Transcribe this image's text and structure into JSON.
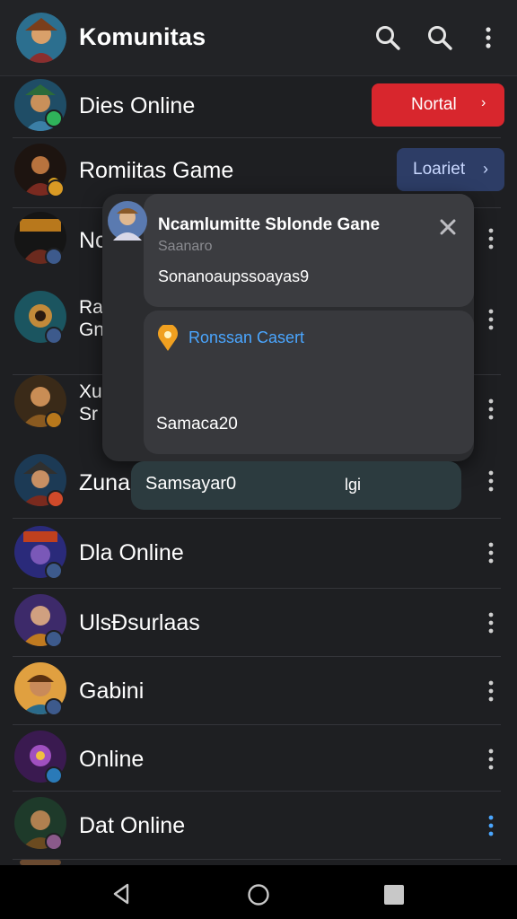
{
  "header": {
    "title": "Komunitas",
    "icons": [
      "search-icon",
      "search-icon",
      "more-vert-icon"
    ]
  },
  "rows": [
    {
      "name": "Dies Online",
      "action": "Nortal"
    },
    {
      "name": "Romiitas Game",
      "action": "Loariet"
    },
    {
      "name": "Nc"
    },
    {
      "name": "Ra\nGn"
    },
    {
      "name": "Xu\nSr"
    },
    {
      "name": "Zuna"
    },
    {
      "name": "Dla Online"
    },
    {
      "name": "UlsĐsurlaas"
    },
    {
      "name": "Gabini"
    },
    {
      "name": "Online"
    },
    {
      "name": "Dat Online"
    }
  ],
  "popup": {
    "title": "Ncamlumitte Sblonde Gane",
    "subtitle": "Saanaro",
    "body1": "Sonanoaupssoayas9",
    "location": "Ronssan Casert",
    "body2": "Samaca20",
    "pill_text": "Samsayar0",
    "pill_tag": "lgi"
  },
  "colors": {
    "accent_red": "#d8262d",
    "accent_blue": "#2d3d66",
    "link_blue": "#4aa6ff"
  },
  "navbar": {
    "buttons": [
      "back-icon",
      "home-icon",
      "recents-icon"
    ]
  }
}
